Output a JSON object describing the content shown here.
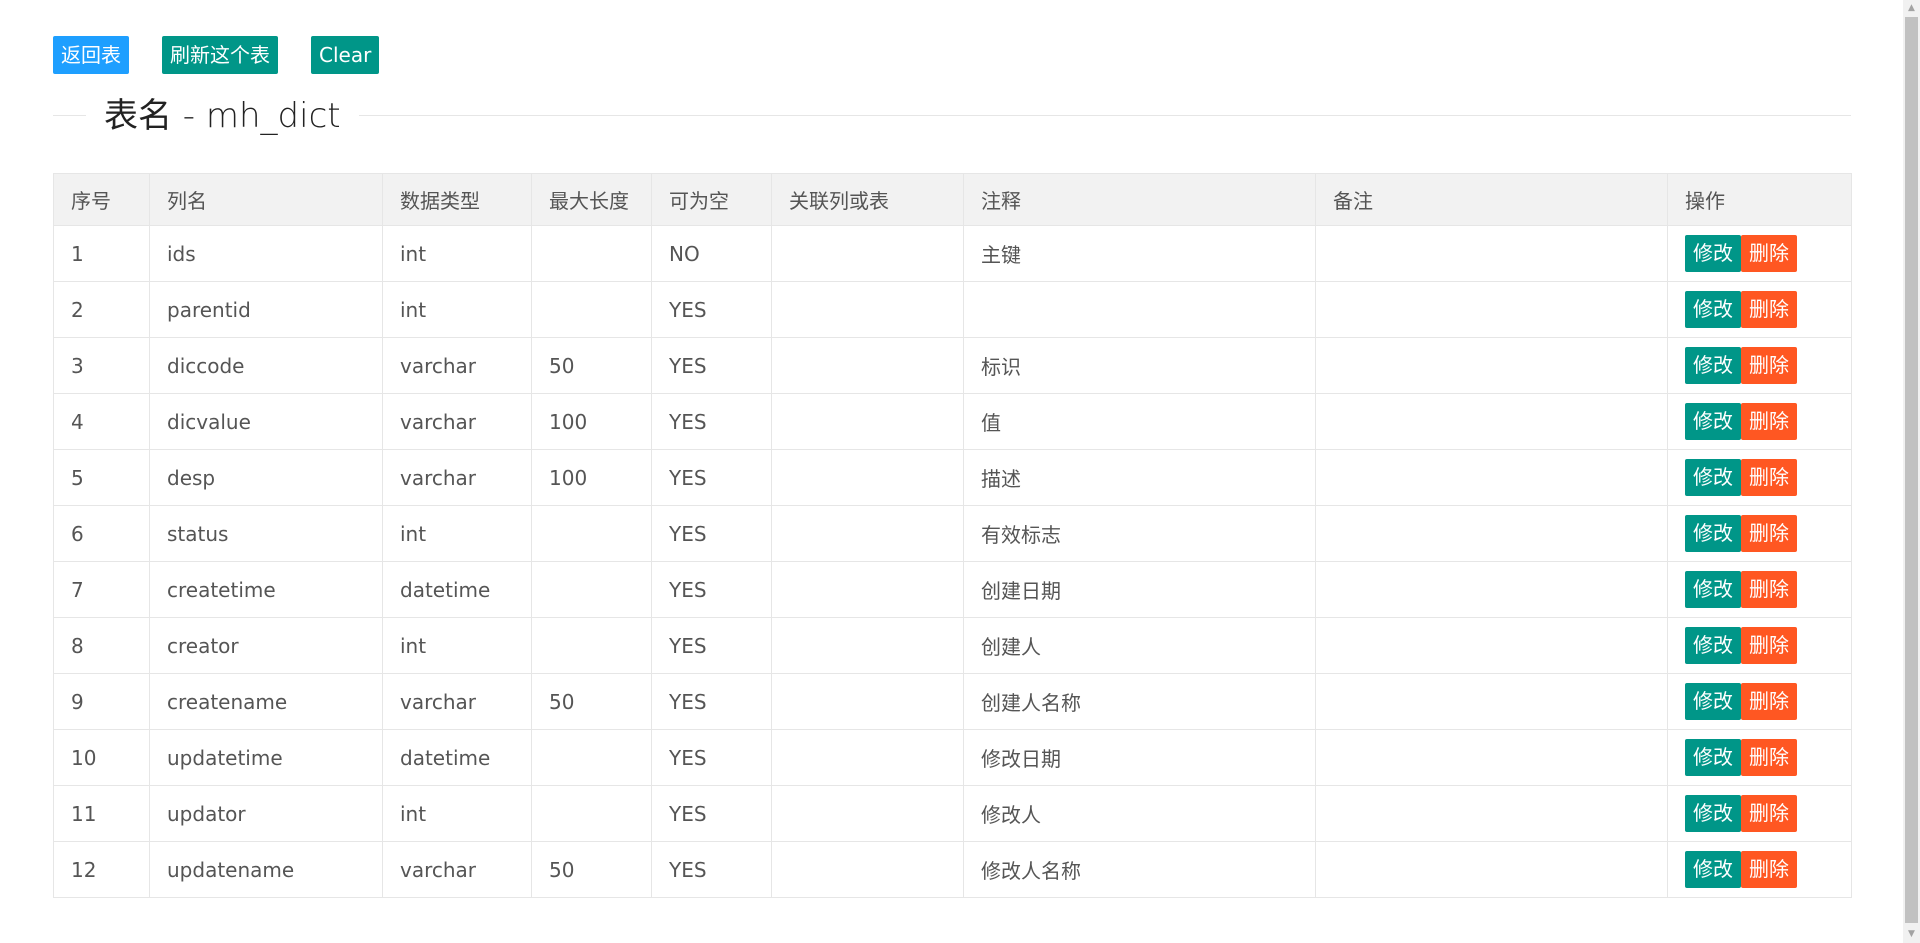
{
  "toolbar": {
    "back_label": "返回表",
    "refresh_label": "刷新这个表",
    "clear_label": "Clear"
  },
  "title": "表名 - mh_dict",
  "table": {
    "headers": [
      "序号",
      "列名",
      "数据类型",
      "最大长度",
      "可为空",
      "关联列或表",
      "注释",
      "备注",
      "操作"
    ],
    "edit_label": "修改",
    "delete_label": "删除",
    "rows": [
      {
        "no": "1",
        "name": "ids",
        "type": "int",
        "maxlen": "",
        "nullable": "NO",
        "ref": "",
        "comment": "主键",
        "remark": ""
      },
      {
        "no": "2",
        "name": "parentid",
        "type": "int",
        "maxlen": "",
        "nullable": "YES",
        "ref": "",
        "comment": "",
        "remark": ""
      },
      {
        "no": "3",
        "name": "diccode",
        "type": "varchar",
        "maxlen": "50",
        "nullable": "YES",
        "ref": "",
        "comment": "标识",
        "remark": ""
      },
      {
        "no": "4",
        "name": "dicvalue",
        "type": "varchar",
        "maxlen": "100",
        "nullable": "YES",
        "ref": "",
        "comment": "值",
        "remark": ""
      },
      {
        "no": "5",
        "name": "desp",
        "type": "varchar",
        "maxlen": "100",
        "nullable": "YES",
        "ref": "",
        "comment": "描述",
        "remark": ""
      },
      {
        "no": "6",
        "name": "status",
        "type": "int",
        "maxlen": "",
        "nullable": "YES",
        "ref": "",
        "comment": "有效标志",
        "remark": ""
      },
      {
        "no": "7",
        "name": "createtime",
        "type": "datetime",
        "maxlen": "",
        "nullable": "YES",
        "ref": "",
        "comment": "创建日期",
        "remark": ""
      },
      {
        "no": "8",
        "name": "creator",
        "type": "int",
        "maxlen": "",
        "nullable": "YES",
        "ref": "",
        "comment": "创建人",
        "remark": ""
      },
      {
        "no": "9",
        "name": "createname",
        "type": "varchar",
        "maxlen": "50",
        "nullable": "YES",
        "ref": "",
        "comment": "创建人名称",
        "remark": ""
      },
      {
        "no": "10",
        "name": "updatetime",
        "type": "datetime",
        "maxlen": "",
        "nullable": "YES",
        "ref": "",
        "comment": "修改日期",
        "remark": ""
      },
      {
        "no": "11",
        "name": "updator",
        "type": "int",
        "maxlen": "",
        "nullable": "YES",
        "ref": "",
        "comment": "修改人",
        "remark": ""
      },
      {
        "no": "12",
        "name": "updatename",
        "type": "varchar",
        "maxlen": "50",
        "nullable": "YES",
        "ref": "",
        "comment": "修改人名称",
        "remark": ""
      }
    ]
  },
  "colors": {
    "primary_blue": "#1E9FFF",
    "primary_green": "#009688",
    "danger_orange": "#FF5722"
  }
}
